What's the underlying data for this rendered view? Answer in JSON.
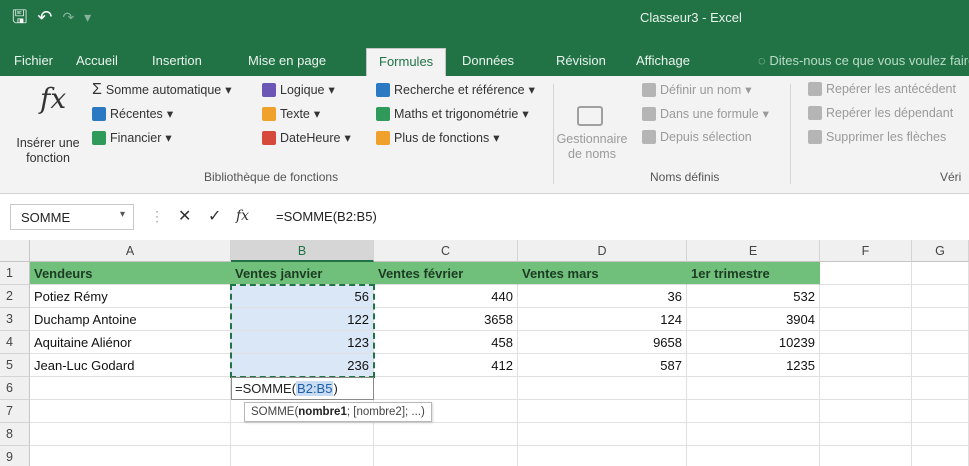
{
  "titlebar": {
    "window_title": "Classeur3 - Excel",
    "save_icon": "save-icon",
    "undo_icon": "undo-icon",
    "redo_icon": "redo-icon",
    "customize_icon": "customize-qat-icon",
    "background_color": "#217346"
  },
  "tabs": {
    "items": [
      "Fichier",
      "Accueil",
      "Insertion",
      "Mise en page",
      "Formules",
      "Données",
      "Révision",
      "Affichage"
    ],
    "active": "Formules",
    "tell_me": "Dites-nous ce que vous voulez faire."
  },
  "ribbon": {
    "insert_function": {
      "icon": "fx",
      "label_line1": "Insérer une",
      "label_line2": "fonction"
    },
    "library": {
      "autosum": "Somme automatique",
      "recent": "Récentes",
      "financial": "Financier",
      "logical": "Logique",
      "text": "Texte",
      "datetime": "DateHeure",
      "lookup": "Recherche et référence",
      "math": "Maths et trigonométrie",
      "more": "Plus de fonctions",
      "group_label": "Bibliothèque de fonctions"
    },
    "names": {
      "manager_line1": "Gestionnaire",
      "manager_line2": "de noms",
      "define_name": "Définir un nom",
      "use_in_formula": "Dans une formule",
      "create_from_selection": "Depuis sélection",
      "group_label": "Noms définis"
    },
    "audit": {
      "trace_precedents": "Repérer les antécédent",
      "trace_dependents": "Repérer les dépendant",
      "remove_arrows": "Supprimer les flèches",
      "group_label": "Véri"
    }
  },
  "formula_bar": {
    "name_box": "SOMME",
    "cancel_glyph": "✕",
    "enter_glyph": "✓",
    "fx_glyph": "fx",
    "formula": "=SOMME(B2:B5)"
  },
  "sheet": {
    "columns": [
      "A",
      "B",
      "C",
      "D",
      "E",
      "F",
      "G"
    ],
    "selected_column": "B",
    "rows": [
      "1",
      "2",
      "3",
      "4",
      "5",
      "6",
      "7",
      "8",
      "9"
    ],
    "header_fill": "#70c07c",
    "header": [
      "Vendeurs",
      "Ventes janvier",
      "Ventes février",
      "Ventes mars",
      "1er trimestre"
    ],
    "data": [
      [
        "Potiez Rémy",
        "56",
        "440",
        "36",
        "532"
      ],
      [
        "Duchamp Antoine",
        "122",
        "3658",
        "124",
        "3904"
      ],
      [
        "Aquitaine Aliénor",
        "123",
        "458",
        "9658",
        "10239"
      ],
      [
        "Jean-Luc Godard",
        "236",
        "412",
        "587",
        "1235"
      ]
    ],
    "edit_cell": {
      "prefix": "=SOMME(",
      "ref": "B2:B5",
      "suffix": ")"
    },
    "tooltip": {
      "fn": "SOMME(",
      "arg1": "nombre1",
      "rest": "; [nombre2]; ...)"
    }
  }
}
